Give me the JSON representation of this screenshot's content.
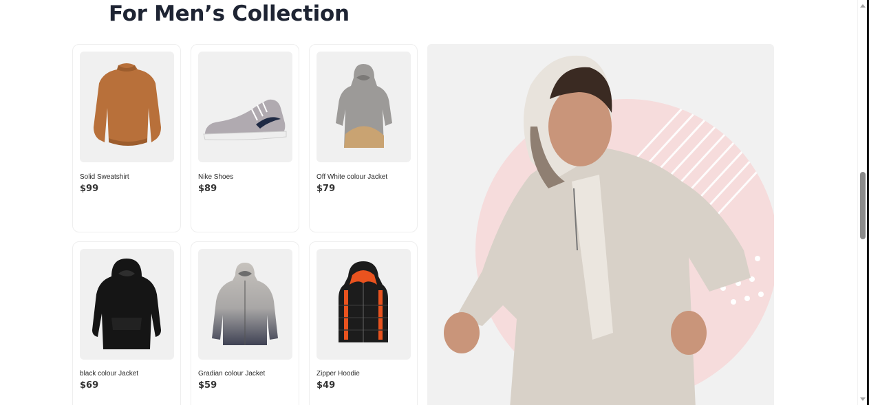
{
  "section": {
    "title": "For Men’s Collection"
  },
  "products": [
    {
      "name": "Solid Sweatshirt",
      "price": "$99",
      "icon": "sweatshirt-icon"
    },
    {
      "name": "Nike Shoes",
      "price": "$89",
      "icon": "shoe-icon"
    },
    {
      "name": "Off White colour Jacket",
      "price": "$79",
      "icon": "jacket-icon"
    },
    {
      "name": "black colour Jacket",
      "price": "$69",
      "icon": "hoodie-icon"
    },
    {
      "name": "Gradian colour Jacket",
      "price": "$59",
      "icon": "jacket-icon"
    },
    {
      "name": "Zipper Hoodie",
      "price": "$49",
      "icon": "vest-icon"
    }
  ],
  "colors": {
    "title": "#1e2433",
    "thumb_bg": "#f0f0f0",
    "hero_bg": "#f1f1f1",
    "hero_circle": "#f6dcdc",
    "sweatshirt": "#b8703a",
    "shoe": "#b0aab0",
    "offwhite_jacket": "#9c9a98",
    "black_jacket": "#151515",
    "gradient_top": "#c6c2bd",
    "gradient_bottom": "#3f4254",
    "vest_body": "#1c1c1c",
    "vest_lining": "#e9531f",
    "hero_jacket": "#d8d1c8"
  }
}
